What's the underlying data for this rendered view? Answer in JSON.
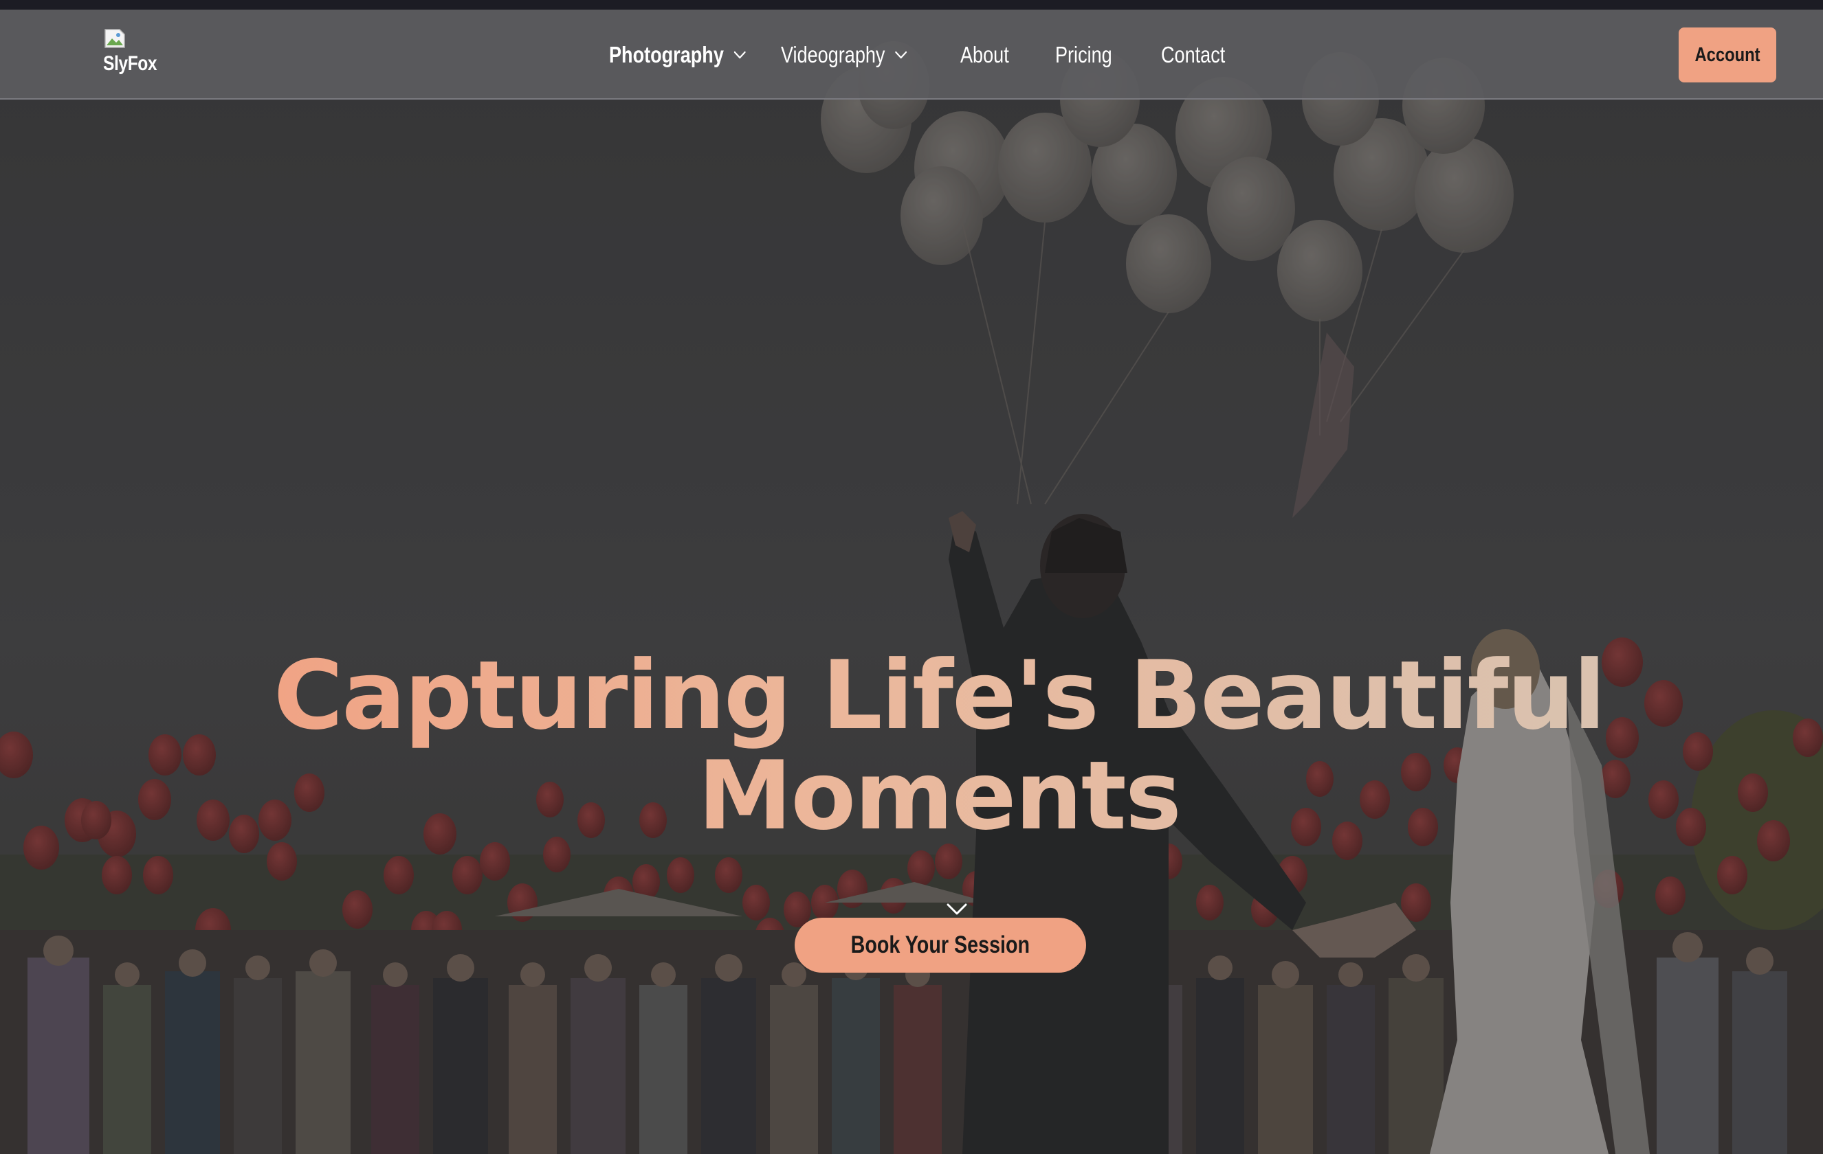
{
  "brand": {
    "logo_alt": "SlyFox",
    "accent_color": "#f0a283"
  },
  "nav": {
    "items": [
      {
        "label": "Photography",
        "has_dropdown": true
      },
      {
        "label": "Videography",
        "has_dropdown": true
      },
      {
        "label": "About",
        "has_dropdown": false
      },
      {
        "label": "Pricing",
        "has_dropdown": false
      },
      {
        "label": "Contact",
        "has_dropdown": false
      }
    ],
    "account_label": "Account"
  },
  "hero": {
    "title": "Capturing Life's Beautiful Moments",
    "cta_label": "Book Your Session",
    "scroll_icon": "chevron-down-icon"
  }
}
